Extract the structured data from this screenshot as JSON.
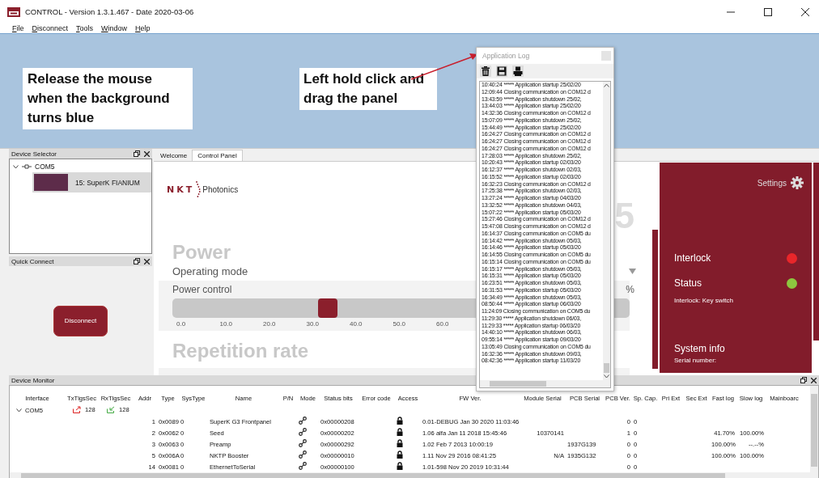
{
  "window": {
    "title": "CONTROL - Version 1.3.1.467 - Date 2020-03-06"
  },
  "menu": [
    "File",
    "Disconnect",
    "Tools",
    "Window",
    "Help"
  ],
  "callouts": [
    {
      "text": "Release the mouse when the background turns blue"
    },
    {
      "text": "Left hold click and drag the panel"
    }
  ],
  "device_selector": {
    "title": "Device Selector",
    "tree": [
      {
        "label": "COM5",
        "expanded": true,
        "children": [
          {
            "label": "15: SuperK FIANIUM",
            "selected": true
          }
        ]
      }
    ]
  },
  "quick_connect": {
    "title": "Quick Connect",
    "button": "Disconnect"
  },
  "tabs": [
    {
      "label": "Welcome",
      "selected": false
    },
    {
      "label": "Control Panel",
      "selected": true
    }
  ],
  "control_panel": {
    "logo_mark": "NKT",
    "logo_text": "Photonics",
    "big_digit": "5",
    "power_title": "Power",
    "operating_mode": "Operating mode",
    "power_control": "Power control",
    "unit": "%",
    "slider": {
      "level": 0.34
    },
    "ticks": [
      "0.0",
      "10.0",
      "20.0",
      "30.0",
      "40.0",
      "50.0",
      "60.0"
    ],
    "repetition_title": "Repetition rate"
  },
  "status_panel": {
    "settings": "Settings",
    "indicators": [
      {
        "label": "Interlock",
        "color": "#e8262a"
      },
      {
        "label": "Status",
        "color": "#8dc63f"
      }
    ],
    "interlock_note": "Interlock: Key switch",
    "system_info": "System info",
    "serial_label": "Serial number:"
  },
  "application_log": {
    "title": "Application Log",
    "lines": [
      "10:40:24 ***** Application startup 25/02/20",
      "12:09:44 Closing communication on COM12 d",
      "13:43:59 ***** Application shutdown 25/02,",
      "13:44:03 ***** Application startup 25/02/20",
      "14:32:36 Closing communication on COM12 d",
      "15:07:09 ***** Application shutdown 25/02,",
      "15:44:49 ***** Application startup 25/02/20",
      "16:24:27 Closing communication on COM12 d",
      "16:24:27 Closing communication on COM12 d",
      "16:24:27 Closing communication on COM12 d",
      "17:28:03 ***** Application shutdown 25/02,",
      "10:20:43 ***** Application startup 02/03/20",
      "16:12:37 ***** Application shutdown 02/03,",
      "16:15:52 ***** Application startup 02/03/20",
      "16:32:23 Closing communication on COM12 d",
      "17:25:38 ***** Application shutdown 02/03,",
      "13:27:24 ***** Application startup 04/03/20",
      "13:32:52 ***** Application shutdown 04/03,",
      "15:07:22 ***** Application startup 05/03/20",
      "15:27:46 Closing communication on COM12 d",
      "15:47:08 Closing communication on COM12 d",
      "16:14:37 Closing communication on COM5 du",
      "16:14:42 ***** Application shutdown 05/03,",
      "16:14:46 ***** Application startup 05/03/20",
      "16:14:55 Closing communication on COM5 du",
      "16:15:14 Closing communication on COM5 du",
      "16:15:17 ***** Application shutdown 05/03,",
      "16:15:31 ***** Application startup 05/03/20",
      "16:23:51 ***** Application shutdown 05/03,",
      "16:31:53 ***** Application startup 05/03/20",
      "16:34:49 ***** Application shutdown 05/03,",
      "08:50:44 ***** Application startup 06/03/20",
      "11:24:09 Closing communication on COM5 du",
      "11:29:30 ***** Application shutdown 06/03,",
      "11:29:33 ***** Application startup 06/03/20",
      "14:40:10 ***** Application shutdown 06/03,",
      "09:55:14 ***** Application startup 09/03/20",
      "13:05:49 Closing communication on COM5 du",
      "16:32:36 ***** Application shutdown 09/03,",
      "08:42:36 ***** Application startup 11/03/20"
    ]
  },
  "device_monitor": {
    "title": "Device Monitor",
    "columns": [
      "Interface",
      "TxTlgsSec",
      "RxTlgsSec",
      "Addr",
      "Type",
      "SysType",
      "Name",
      "P/N",
      "Mode",
      "Status bits",
      "Error code",
      "Access",
      "FW Ver.",
      "Module Serial",
      "PCB Serial",
      "PCB Ver.",
      "Sp. Cap.",
      "Pri Ext",
      "Sec Ext",
      "Fast log",
      "Slow log",
      "Mainboarc"
    ],
    "group": {
      "interface": "COM5",
      "expanded": true,
      "tx": "128",
      "rx": "128"
    },
    "rows": [
      {
        "addr": "1",
        "type": "0x0089",
        "systype": "0",
        "name": "SuperK G3 Frontpanel",
        "status_bits": "0x00000208",
        "fw": "0.01-DEBUG Jan 30 2020 11:03:46",
        "module_serial": "",
        "pcb_serial": "",
        "pcb_ver": "0",
        "sp_cap": "0",
        "fast_log": "",
        "slow_log": ""
      },
      {
        "addr": "2",
        "type": "0x0062",
        "systype": "0",
        "name": "Seed",
        "status_bits": "0x00000202",
        "fw": "1.06 alfa Jan 11 2018 15:45:46",
        "module_serial": "10370141",
        "pcb_serial": "",
        "pcb_ver": "1",
        "sp_cap": "0",
        "fast_log": "41.70%",
        "slow_log": "100.00%"
      },
      {
        "addr": "3",
        "type": "0x0063",
        "systype": "0",
        "name": "Preamp",
        "status_bits": "0x00000292",
        "fw": "1.02 Feb  7 2013 10:00:19",
        "module_serial": "",
        "pcb_serial": "1937G139",
        "pcb_ver": "0",
        "sp_cap": "0",
        "fast_log": "100.00%",
        "slow_log": "--.--%"
      },
      {
        "addr": "5",
        "type": "0x006A",
        "systype": "0",
        "name": "NKTP Booster",
        "status_bits": "0x00000010",
        "fw": "1.11 Nov 29 2016 08:41:25",
        "module_serial": "N/A",
        "pcb_serial": "1935G132",
        "pcb_ver": "0",
        "sp_cap": "0",
        "fast_log": "100.00%",
        "slow_log": "100.00%"
      },
      {
        "addr": "14",
        "type": "0x0081",
        "systype": "0",
        "name": "EthernetToSerial",
        "status_bits": "0x00000100",
        "fw": "1.01-598 Nov 20 2019 10:31:44",
        "module_serial": "",
        "pcb_serial": "",
        "pcb_ver": "0",
        "sp_cap": "0",
        "fast_log": "",
        "slow_log": ""
      }
    ]
  }
}
